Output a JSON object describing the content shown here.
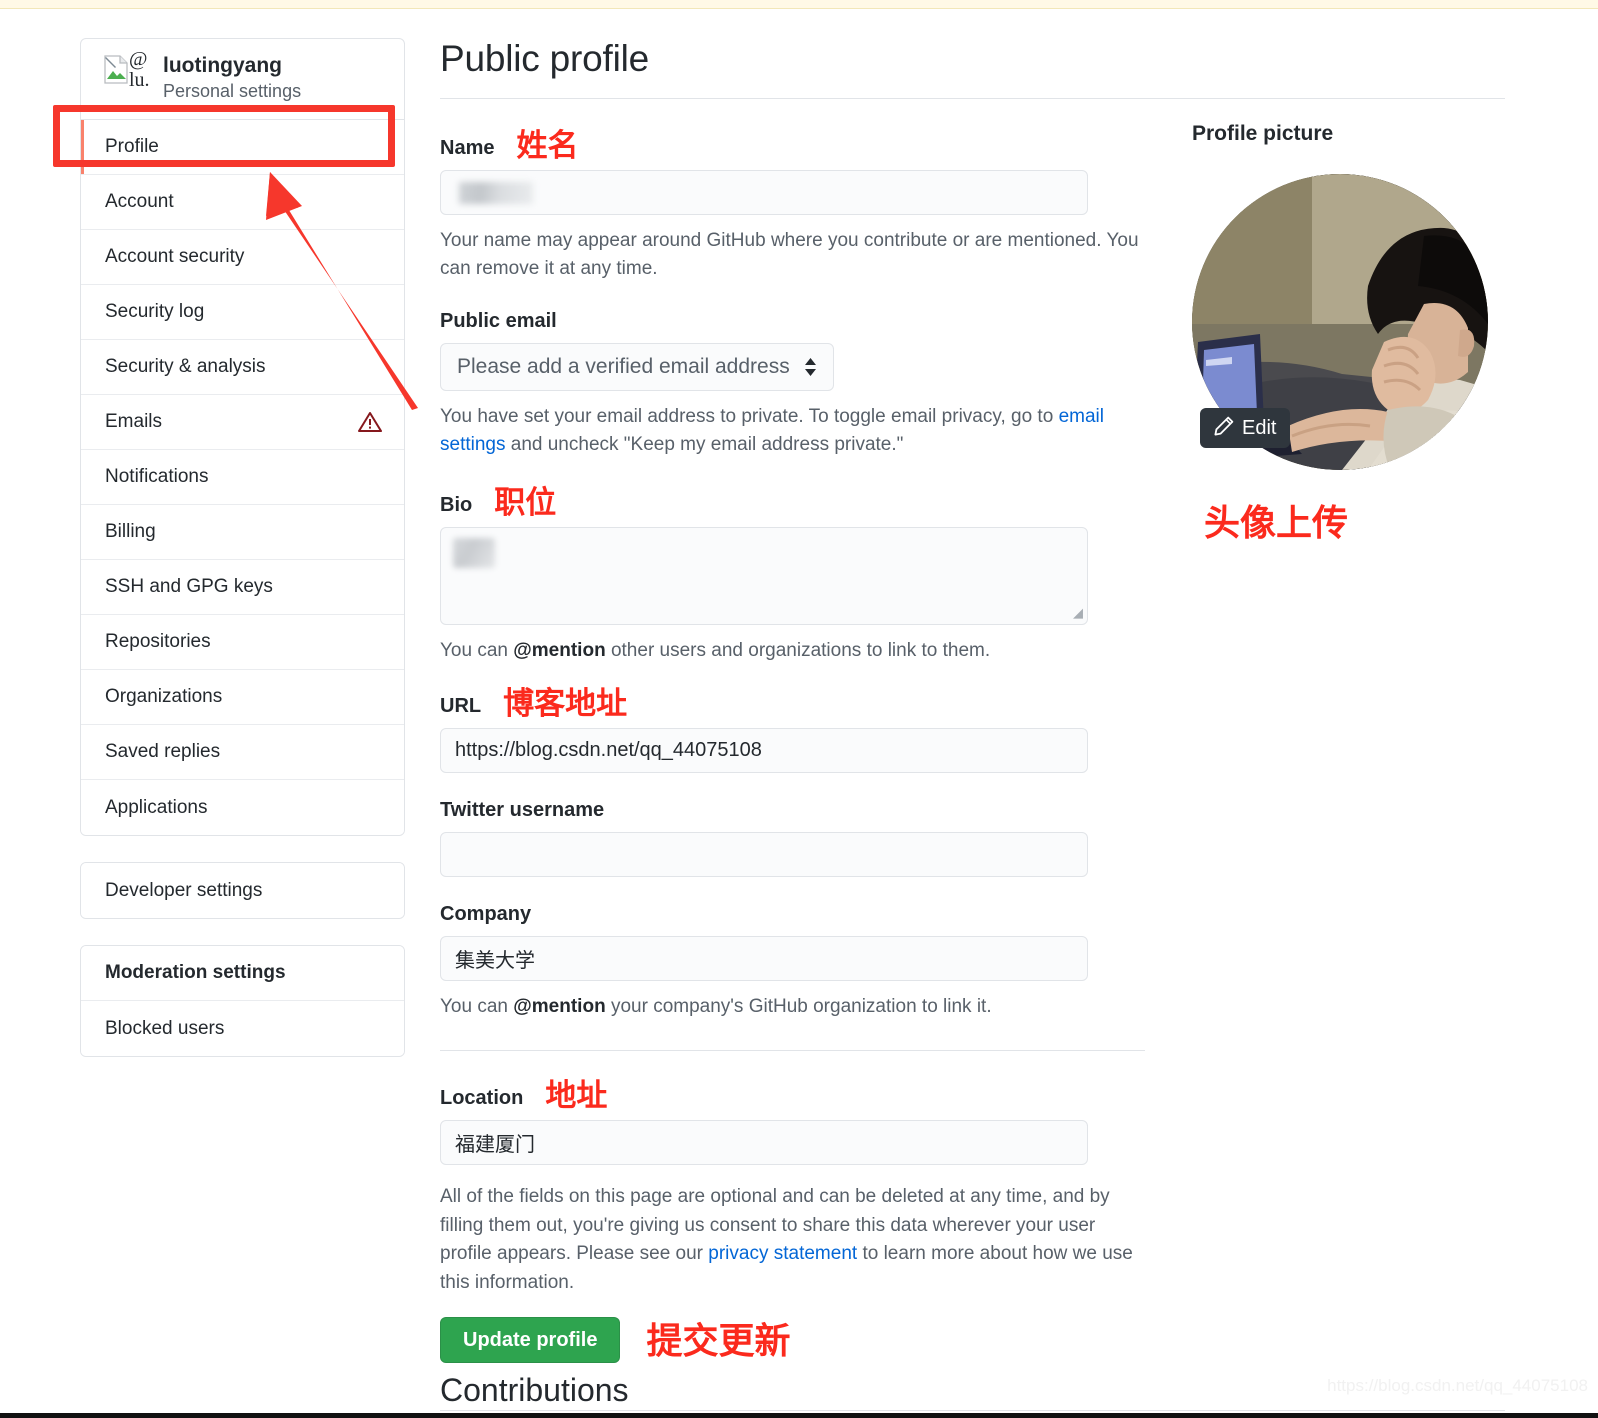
{
  "sidebar": {
    "user": {
      "login": "luotingyang",
      "subtitle": "Personal settings",
      "avatar_alt": "@\nlu."
    },
    "nav_items": [
      {
        "label": "Profile",
        "selected": true,
        "badge": null
      },
      {
        "label": "Account",
        "selected": false,
        "badge": null
      },
      {
        "label": "Account security",
        "selected": false,
        "badge": null
      },
      {
        "label": "Security log",
        "selected": false,
        "badge": null
      },
      {
        "label": "Security & analysis",
        "selected": false,
        "badge": null
      },
      {
        "label": "Emails",
        "selected": false,
        "badge": "warning-icon"
      },
      {
        "label": "Notifications",
        "selected": false,
        "badge": null
      },
      {
        "label": "Billing",
        "selected": false,
        "badge": null
      },
      {
        "label": "SSH and GPG keys",
        "selected": false,
        "badge": null
      },
      {
        "label": "Repositories",
        "selected": false,
        "badge": null
      },
      {
        "label": "Organizations",
        "selected": false,
        "badge": null
      },
      {
        "label": "Saved replies",
        "selected": false,
        "badge": null
      },
      {
        "label": "Applications",
        "selected": false,
        "badge": null
      }
    ],
    "developer_settings": "Developer settings",
    "moderation_heading": "Moderation settings",
    "blocked_users": "Blocked users"
  },
  "main": {
    "title": "Public profile",
    "name": {
      "label": "Name",
      "annotation": "姓名",
      "value": "",
      "hint": "Your name may appear around GitHub where you contribute or are mentioned. You can remove it at any time."
    },
    "public_email": {
      "label": "Public email",
      "selected_option": "Please add a verified email address",
      "hint_before": "You have set your email address to private. To toggle email privacy, go to ",
      "hint_link": "email settings",
      "hint_after": " and uncheck \"Keep my email address private.\""
    },
    "bio": {
      "label": "Bio",
      "annotation": "职位",
      "value": "",
      "hint_before": "You can ",
      "hint_bold": "@mention",
      "hint_after": " other users and organizations to link to them."
    },
    "url": {
      "label": "URL",
      "annotation": "博客地址",
      "value": "https://blog.csdn.net/qq_44075108"
    },
    "twitter": {
      "label": "Twitter username",
      "value": ""
    },
    "company": {
      "label": "Company",
      "value": "集美大学",
      "hint_before": "You can ",
      "hint_bold": "@mention",
      "hint_after": " your company's GitHub organization to link it."
    },
    "location": {
      "label": "Location",
      "annotation": "地址",
      "value": "福建厦门"
    },
    "legal_before": "All of the fields on this page are optional and can be deleted at any time, and by filling them out, you're giving us consent to share this data wherever your user profile appears. Please see our ",
    "legal_link": "privacy statement",
    "legal_after": " to learn more about how we use this information.",
    "update_button": "Update profile",
    "update_annotation": "提交更新",
    "bottom_heading": "Contributions"
  },
  "right": {
    "label": "Profile picture",
    "edit_button": "Edit",
    "annotation": "头像上传"
  },
  "watermark": "https://blog.csdn.net/qq_44075108",
  "colors": {
    "accent_green": "#2ea44f",
    "link_blue": "#0366d6",
    "annotation_red": "#fb2a1d",
    "selected_bar": "#f9826c",
    "warning_red": "#86181d"
  }
}
